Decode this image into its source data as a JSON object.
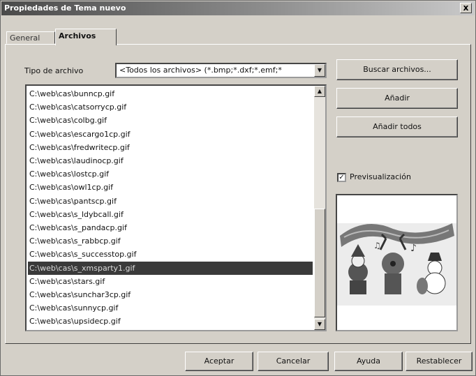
{
  "window": {
    "title": "Propiedades de Tema nuevo",
    "close_glyph": "x"
  },
  "tabs": [
    {
      "label": "General",
      "active": false
    },
    {
      "label": "Archivos",
      "active": true
    }
  ],
  "file_type": {
    "label": "Tipo de archivo",
    "value": "<Todos los archivos> (*.bmp;*.dxf;*.emf;*",
    "arrow_icon": "chevron-down-icon"
  },
  "file_list": {
    "items": [
      "C:\\web\\cas\\bunncp.gif",
      "C:\\web\\cas\\catsorrycp.gif",
      "C:\\web\\cas\\colbg.gif",
      "C:\\web\\cas\\escargo1cp.gif",
      "C:\\web\\cas\\fredwritecp.gif",
      "C:\\web\\cas\\laudinocp.gif",
      "C:\\web\\cas\\lostcp.gif",
      "C:\\web\\cas\\owl1cp.gif",
      "C:\\web\\cas\\pantscp.gif",
      "C:\\web\\cas\\s_ldybcall.gif",
      "C:\\web\\cas\\s_pandacp.gif",
      "C:\\web\\cas\\s_rabbcp.gif",
      "C:\\web\\cas\\s_successtop.gif",
      "C:\\web\\cas\\s_xmsparty1.gif",
      "C:\\web\\cas\\stars.gif",
      "C:\\web\\cas\\sunchar3cp.gif",
      "C:\\web\\cas\\sunnycp.gif",
      "C:\\web\\cas\\upsidecp.gif"
    ],
    "selected_index": 13,
    "scroll_up_glyph": "▲",
    "scroll_down_glyph": "▼"
  },
  "actions": {
    "buscar": "Buscar archivos...",
    "anadir": "Añadir",
    "anadir_todos": "Añadir todos"
  },
  "preview": {
    "checkbox_label": "Previsualización",
    "checked": true,
    "check_glyph": "✓",
    "image": "christmas-party-clipart"
  },
  "footer": {
    "aceptar": "Aceptar",
    "cancelar": "Cancelar",
    "ayuda": "Ayuda",
    "restablecer": "Restablecer"
  },
  "colors": {
    "selection": "#3a3a3a",
    "dialog_bg": "#d4d0c8"
  }
}
